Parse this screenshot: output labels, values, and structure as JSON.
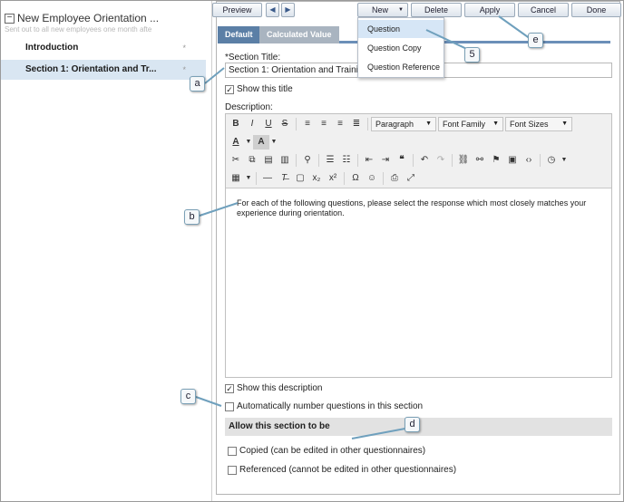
{
  "sidebar": {
    "collapse_symbol": "−",
    "title": "New Employee Orientation ...",
    "subtitle": "Sent out to all new employees one month afte",
    "items": [
      {
        "label": "Introduction",
        "marker": "*"
      },
      {
        "label": "Section 1: Orientation and Tr...",
        "marker": "*"
      }
    ]
  },
  "toolbar": {
    "preview": "Preview",
    "prev_icon": "◀",
    "next_icon": "▶",
    "new": "New",
    "new_dropdown_icon": "▼",
    "delete": "Delete",
    "apply": "Apply",
    "cancel": "Cancel",
    "done": "Done"
  },
  "new_menu": {
    "items": [
      "Question",
      "Question Copy",
      "Question Reference"
    ]
  },
  "tabs": {
    "default": "Default",
    "calculated": "Calculated Value"
  },
  "form": {
    "section_title_label": "*Section Title:",
    "section_title_value": "Section 1: Orientation and Training",
    "show_title_label": "Show this title",
    "show_title_checked": true,
    "description_label": "Description:",
    "description_text": "For each of the following questions, please select the response which most closely matches your experience during orientation.",
    "show_description_label": "Show this description",
    "show_description_checked": true,
    "auto_number_label": "Automatically number questions in this section",
    "auto_number_checked": false,
    "allow_header": "Allow this section to be",
    "copied_label": "Copied (can be edited in other questionnaires)",
    "copied_checked": false,
    "referenced_label": "Referenced (cannot be edited in other questionnaires)",
    "referenced_checked": false
  },
  "editor_toolbar": {
    "paragraph": "Paragraph",
    "font_family": "Font Family",
    "font_sizes": "Font Sizes",
    "bold": "B",
    "italic": "I",
    "underline": "U",
    "strike": "S",
    "font_color": "A",
    "bg_color": "A",
    "omega": "Ω",
    "subscript": "x₂",
    "superscript": "x²"
  },
  "check_mark": "✓",
  "callouts": {
    "a": "a",
    "b": "b",
    "c": "c",
    "d": "d",
    "e": "e",
    "five": "5"
  },
  "colors": {
    "accent": "#5b7fa6",
    "selected_row": "#d9e6f2",
    "menu_highlight": "#d6e6f6",
    "callout_line": "#6fa0bd"
  }
}
